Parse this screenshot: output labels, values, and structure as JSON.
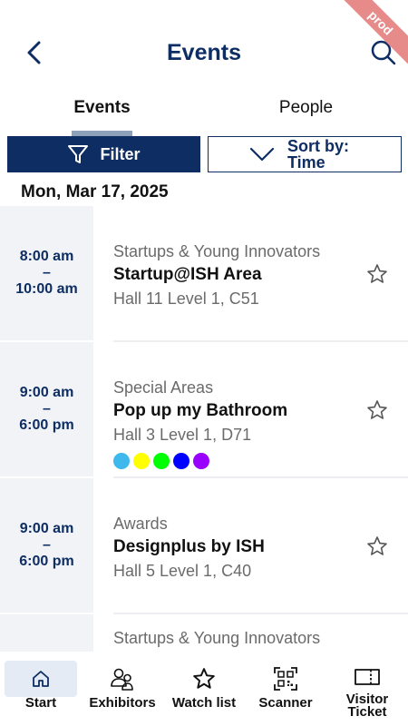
{
  "header": {
    "title": "Events"
  },
  "ribbon": {
    "label": "prod"
  },
  "tabs": [
    {
      "label": "Events",
      "active": true
    },
    {
      "label": "People",
      "active": false
    }
  ],
  "toolbar": {
    "filter_label": "Filter",
    "sort_label": "Sort by: Time"
  },
  "date_heading": "Mon, Mar 17, 2025",
  "events": [
    {
      "start": "8:00 am",
      "separator": "–",
      "end": "10:00 am",
      "category": "Startups & Young Innovators",
      "name": "Startup@ISH Area",
      "location": "Hall 11 Level 1, C51",
      "tag_colors": []
    },
    {
      "start": "9:00 am",
      "separator": "–",
      "end": "6:00 pm",
      "category": "Special Areas",
      "name": "Pop up my Bathroom",
      "location": "Hall 3 Level 1, D71",
      "tag_colors": [
        "#3fb8ee",
        "#ffff00",
        "#00ff00",
        "#0000ff",
        "#9900ff"
      ]
    },
    {
      "start": "9:00 am",
      "separator": "–",
      "end": "6:00 pm",
      "category": "Awards",
      "name": "Designplus by ISH",
      "location": "Hall 5 Level 1, C40",
      "tag_colors": []
    },
    {
      "start": "",
      "separator": "",
      "end": "",
      "category": "Startups & Young Innovators",
      "name": "",
      "location": "",
      "tag_colors": []
    }
  ],
  "nav": [
    {
      "label": "Start",
      "icon": "home-icon",
      "active": true
    },
    {
      "label": "Exhibitors",
      "icon": "people-icon",
      "active": false
    },
    {
      "label": "Watch list",
      "icon": "star-icon",
      "active": false
    },
    {
      "label": "Scanner",
      "icon": "qr-icon",
      "active": false
    },
    {
      "label": "Visitor Ticket",
      "icon": "ticket-icon",
      "active": false
    }
  ],
  "colors": {
    "primary": "#0d2d63",
    "ribbon": "#e68a8a",
    "time_bg": "#f1f3f6"
  }
}
